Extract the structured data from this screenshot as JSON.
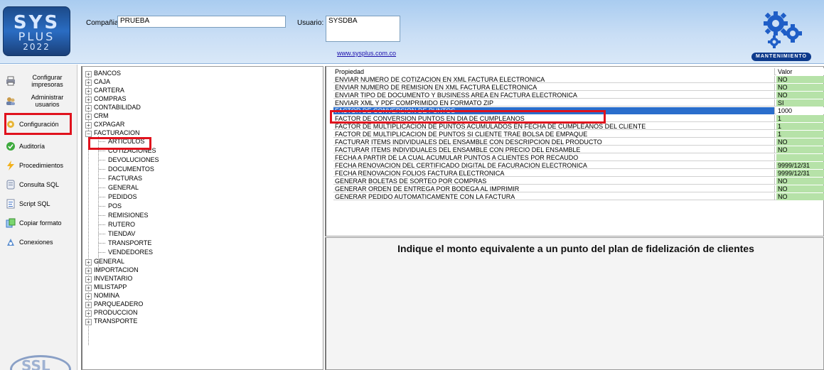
{
  "header": {
    "logo": {
      "line1": "SYS",
      "line2": "PLUS",
      "line3": "2022"
    },
    "company_label": "Compañia:",
    "company_value": "PRUEBA",
    "user_label": "Usuario:",
    "user_value": "SYSDBA",
    "website": "www.sysplus.com.co",
    "mode_badge": "MANTENIMIENTO",
    "gear_icon": "gears-icon",
    "accent_color": "#0d3a8c"
  },
  "sidebar": {
    "items": [
      {
        "label": "Configurar impresoras",
        "icon": "printer-icon"
      },
      {
        "label": "Administrar usuarios",
        "icon": "users-icon"
      },
      {
        "label": "Configuración",
        "icon": "gear-icon"
      },
      {
        "label": "Auditoría",
        "icon": "check-icon"
      },
      {
        "label": "Procedimientos",
        "icon": "lightning-icon"
      },
      {
        "label": "Consulta SQL",
        "icon": "database-icon"
      },
      {
        "label": "Script SQL",
        "icon": "script-icon"
      },
      {
        "label": "Copiar formato",
        "icon": "copy-icon"
      },
      {
        "label": "Conexiones",
        "icon": "connection-icon"
      }
    ],
    "bottom_logo": "SSL",
    "highlight_color": "#e0121d"
  },
  "tree": {
    "top": [
      "BANCOS",
      "CAJA",
      "CARTERA",
      "COMPRAS",
      "CONTABILIDAD",
      "CRM",
      "CXPAGAR"
    ],
    "expanded": "FACTURACION",
    "children": [
      "ARTICULOS",
      "COTIZACIONES",
      "DEVOLUCIONES",
      "DOCUMENTOS",
      "FACTURAS",
      "GENERAL",
      "PEDIDOS",
      "POS",
      "REMISIONES",
      "RUTERO",
      "TIENDAV",
      "TRANSPORTE",
      "VENDEDORES"
    ],
    "bottom": [
      "GENERAL",
      "IMPORTACION",
      "INVENTARIO",
      "MILISTAPP",
      "NOMINA",
      "PARQUEADERO",
      "PRODUCCION",
      "TRANSPORTE"
    ]
  },
  "grid": {
    "col_property": "Propiedad",
    "col_value": "Valor",
    "rows": [
      {
        "prop": "ENVIAR NUMERO DE COTIZACION EN XML FACTURA ELECTRONICA",
        "val": "NO"
      },
      {
        "prop": "ENVIAR NUMERO DE REMISION EN XML FACTURA ELECTRONICA",
        "val": "NO"
      },
      {
        "prop": "ENVIAR TIPO DE DOCUMENTO Y BUSINESS AREA EN FACTURA ELECTRONICA",
        "val": "NO"
      },
      {
        "prop": "ENVIAR XML Y PDF COMPRIMIDO EN FORMATO ZIP",
        "val": "SI"
      },
      {
        "prop": "FACTOR DE CONVERSION DE PUNTOS",
        "val": "1000"
      },
      {
        "prop": "FACTOR DE CONVERSION PUNTOS EN DIA DE CUMPLEANOS",
        "val": "1"
      },
      {
        "prop": "FACTOR DE MULTIPLICACION DE PUNTOS ACUMULADOS EN FECHA DE CUMPLEANOS DEL CLIENTE",
        "val": "1"
      },
      {
        "prop": "FACTOR DE MULTIPLICACION DE PUNTOS SI CLIENTE TRAE BOLSA DE EMPAQUE",
        "val": "1"
      },
      {
        "prop": "FACTURAR ITEMS INDIVIDUALES DEL ENSAMBLE CON DESCRIPCION DEL PRODUCTO",
        "val": "NO"
      },
      {
        "prop": "FACTURAR ITEMS INDIVIDUALES DEL ENSAMBLE CON PRECIO DEL ENSAMBLE",
        "val": "NO"
      },
      {
        "prop": "FECHA A PARTIR DE LA CUAL ACUMULAR PUNTOS A CLIENTES POR RECAUDO",
        "val": ""
      },
      {
        "prop": "FECHA RENOVACION DEL CERTIFICADO DIGITAL DE FACURACION ELECTRONICA",
        "val": "9999/12/31"
      },
      {
        "prop": "FECHA RENOVACION FOLIOS FACTURA ELECTRONICA",
        "val": "9999/12/31"
      },
      {
        "prop": "GENERAR BOLETAS DE SORTEO POR COMPRAS",
        "val": "NO"
      },
      {
        "prop": "GENERAR ORDEN DE ENTREGA POR BODEGA AL IMPRIMIR",
        "val": "NO"
      },
      {
        "prop": "GENERAR PEDIDO AUTOMATICAMENTE CON LA FACTURA",
        "val": "NO"
      }
    ],
    "selected_index": 4,
    "value_bg_color": "#b6e2a8",
    "selection_color": "#2a6ecc"
  },
  "description": "Indique el monto equivalente a un punto del plan de fidelización de clientes"
}
